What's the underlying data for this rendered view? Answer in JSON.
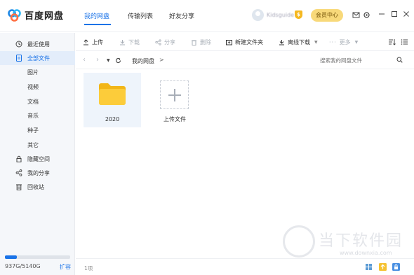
{
  "app": {
    "logo_text": "百度网盘"
  },
  "nav": {
    "tabs": [
      {
        "label": "我的网盘"
      },
      {
        "label": "传输列表"
      },
      {
        "label": "好友分享"
      }
    ],
    "username": "Kidsguide",
    "vip_badge": "$",
    "vip_button": "会员中心"
  },
  "sidebar": {
    "items": [
      {
        "label": "最近使用",
        "icon": "clock-icon"
      },
      {
        "label": "全部文件",
        "icon": "file-icon"
      },
      {
        "label": "隐藏空间",
        "icon": "lock-icon"
      },
      {
        "label": "我的分享",
        "icon": "share-icon"
      },
      {
        "label": "回收站",
        "icon": "trash-icon"
      }
    ],
    "sub_items": [
      {
        "label": "图片"
      },
      {
        "label": "视频"
      },
      {
        "label": "文档"
      },
      {
        "label": "音乐"
      },
      {
        "label": "种子"
      },
      {
        "label": "其它"
      }
    ],
    "quota": {
      "text": "937G/5140G",
      "expand": "扩容",
      "used_fraction": 0.18
    }
  },
  "toolbar": {
    "upload": "上传",
    "download": "下载",
    "share": "分享",
    "delete": "删除",
    "new_folder": "新建文件夹",
    "offline_download": "离线下载",
    "more": "更多"
  },
  "path": {
    "breadcrumb": "我的网盘",
    "separator": ">",
    "search_placeholder": "搜索我的网盘文件"
  },
  "files": {
    "folder_name": "2020",
    "upload_label": "上传文件"
  },
  "status": {
    "count": "1项"
  },
  "watermark": {
    "text": "当下软件园",
    "url": "www.downxia.com"
  },
  "colors": {
    "accent": "#1a73e8",
    "folder": "#f7c335",
    "vip": "#f8d97a"
  }
}
